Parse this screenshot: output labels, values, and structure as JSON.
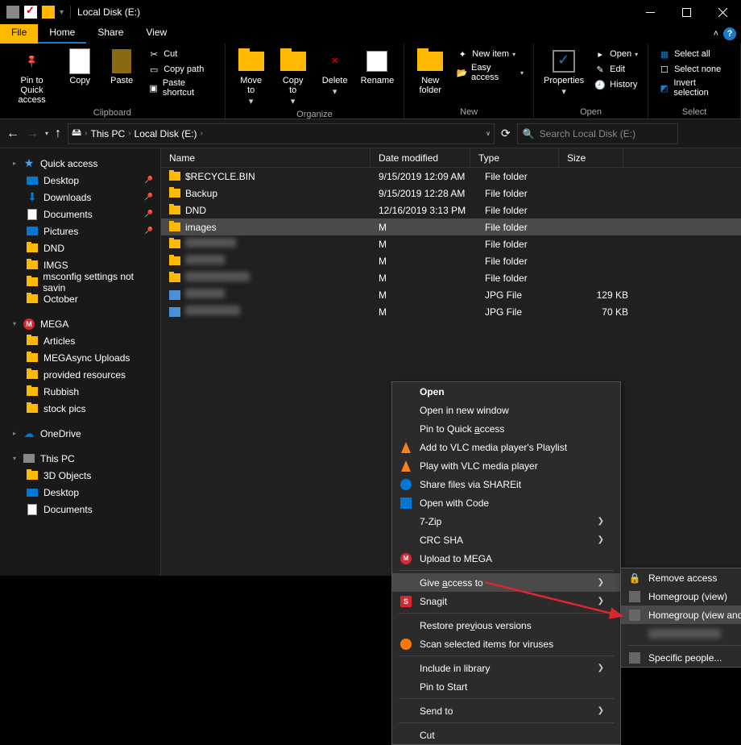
{
  "titlebar": {
    "title": "Local Disk (E:)"
  },
  "menubar": {
    "file": "File",
    "tabs": [
      "Home",
      "Share",
      "View"
    ]
  },
  "ribbon": {
    "groups": [
      "Clipboard",
      "Organize",
      "New",
      "Open",
      "Select"
    ],
    "pin": "Pin to Quick\naccess",
    "copy": "Copy",
    "paste": "Paste",
    "cut": "Cut",
    "copy_path": "Copy path",
    "paste_shortcut": "Paste shortcut",
    "move_to": "Move\nto",
    "copy_to": "Copy\nto",
    "delete": "Delete",
    "rename": "Rename",
    "new_folder": "New\nfolder",
    "new_item": "New item",
    "easy_access": "Easy access",
    "properties": "Properties",
    "open": "Open",
    "edit": "Edit",
    "history": "History",
    "select_all": "Select all",
    "select_none": "Select none",
    "invert_selection": "Invert selection"
  },
  "breadcrumb": {
    "this_pc": "This PC",
    "location": "Local Disk (E:)"
  },
  "search": {
    "placeholder": "Search Local Disk (E:)"
  },
  "sidebar": {
    "quick_access": "Quick access",
    "qa_items": [
      "Desktop",
      "Downloads",
      "Documents",
      "Pictures",
      "DND",
      "IMGS",
      "msconfig settings not savin",
      "October"
    ],
    "mega": "MEGA",
    "mega_items": [
      "Articles",
      "MEGAsync Uploads",
      "provided resources",
      "Rubbish",
      "stock pics"
    ],
    "onedrive": "OneDrive",
    "this_pc": "This PC",
    "pc_items": [
      "3D Objects",
      "Desktop",
      "Documents"
    ]
  },
  "columns": {
    "name": "Name",
    "date": "Date modified",
    "type": "Type",
    "size": "Size"
  },
  "files": [
    {
      "name": "$RECYCLE.BIN",
      "date": "9/15/2019 12:09 AM",
      "type": "File folder",
      "size": ""
    },
    {
      "name": "Backup",
      "date": "9/15/2019 12:28 AM",
      "type": "File folder",
      "size": ""
    },
    {
      "name": "DND",
      "date": "12/16/2019 3:13 PM",
      "type": "File folder",
      "size": ""
    },
    {
      "name": "images",
      "date": "",
      "type": "File folder",
      "size": "",
      "selected": true
    },
    {
      "name": "",
      "date": "",
      "type": "File folder",
      "size": "",
      "blurred": true
    },
    {
      "name": "",
      "date": "",
      "type": "File folder",
      "size": "",
      "blurred": true
    },
    {
      "name": "",
      "date": "",
      "type": "File folder",
      "size": "",
      "blurred": true
    },
    {
      "name": "",
      "date": "",
      "type": "JPG File",
      "size": "129 KB",
      "blurred": true,
      "img": true
    },
    {
      "name": "",
      "date": "",
      "type": "JPG File",
      "size": "70 KB",
      "blurred": true,
      "img": true
    }
  ],
  "context_menu": [
    {
      "label": "Open",
      "bold": true
    },
    {
      "label": "Open in new window"
    },
    {
      "label": "Pin to Quick access"
    },
    {
      "label": "Add to VLC media player's Playlist",
      "icon": "vlc"
    },
    {
      "label": "Play with VLC media player",
      "icon": "vlc"
    },
    {
      "label": "Share files via SHAREit",
      "icon": "shareit"
    },
    {
      "label": "Open with Code",
      "icon": "vscode"
    },
    {
      "label": "7-Zip",
      "submenu": true
    },
    {
      "label": "CRC SHA",
      "submenu": true
    },
    {
      "label": "Upload to MEGA",
      "icon": "mega"
    },
    {
      "sep": true
    },
    {
      "label": "Give access to",
      "submenu": true,
      "hover": true
    },
    {
      "label": "Snagit",
      "icon": "snagit",
      "submenu": true
    },
    {
      "sep": true
    },
    {
      "label": "Restore previous versions"
    },
    {
      "label": "Scan selected items for viruses",
      "icon": "avast"
    },
    {
      "sep": true
    },
    {
      "label": "Include in library",
      "submenu": true
    },
    {
      "label": "Pin to Start"
    },
    {
      "sep": true
    },
    {
      "label": "Send to",
      "submenu": true
    },
    {
      "sep": true
    },
    {
      "label": "Cut"
    }
  ],
  "submenu": [
    {
      "label": "Remove access",
      "icon": "lock"
    },
    {
      "label": "Homegroup (view)",
      "icon": "people"
    },
    {
      "label": "Homegroup (view and edit)",
      "icon": "people",
      "hover": true
    },
    {
      "blurred": true
    },
    {
      "sep": true
    },
    {
      "label": "Specific people...",
      "icon": "people"
    }
  ]
}
